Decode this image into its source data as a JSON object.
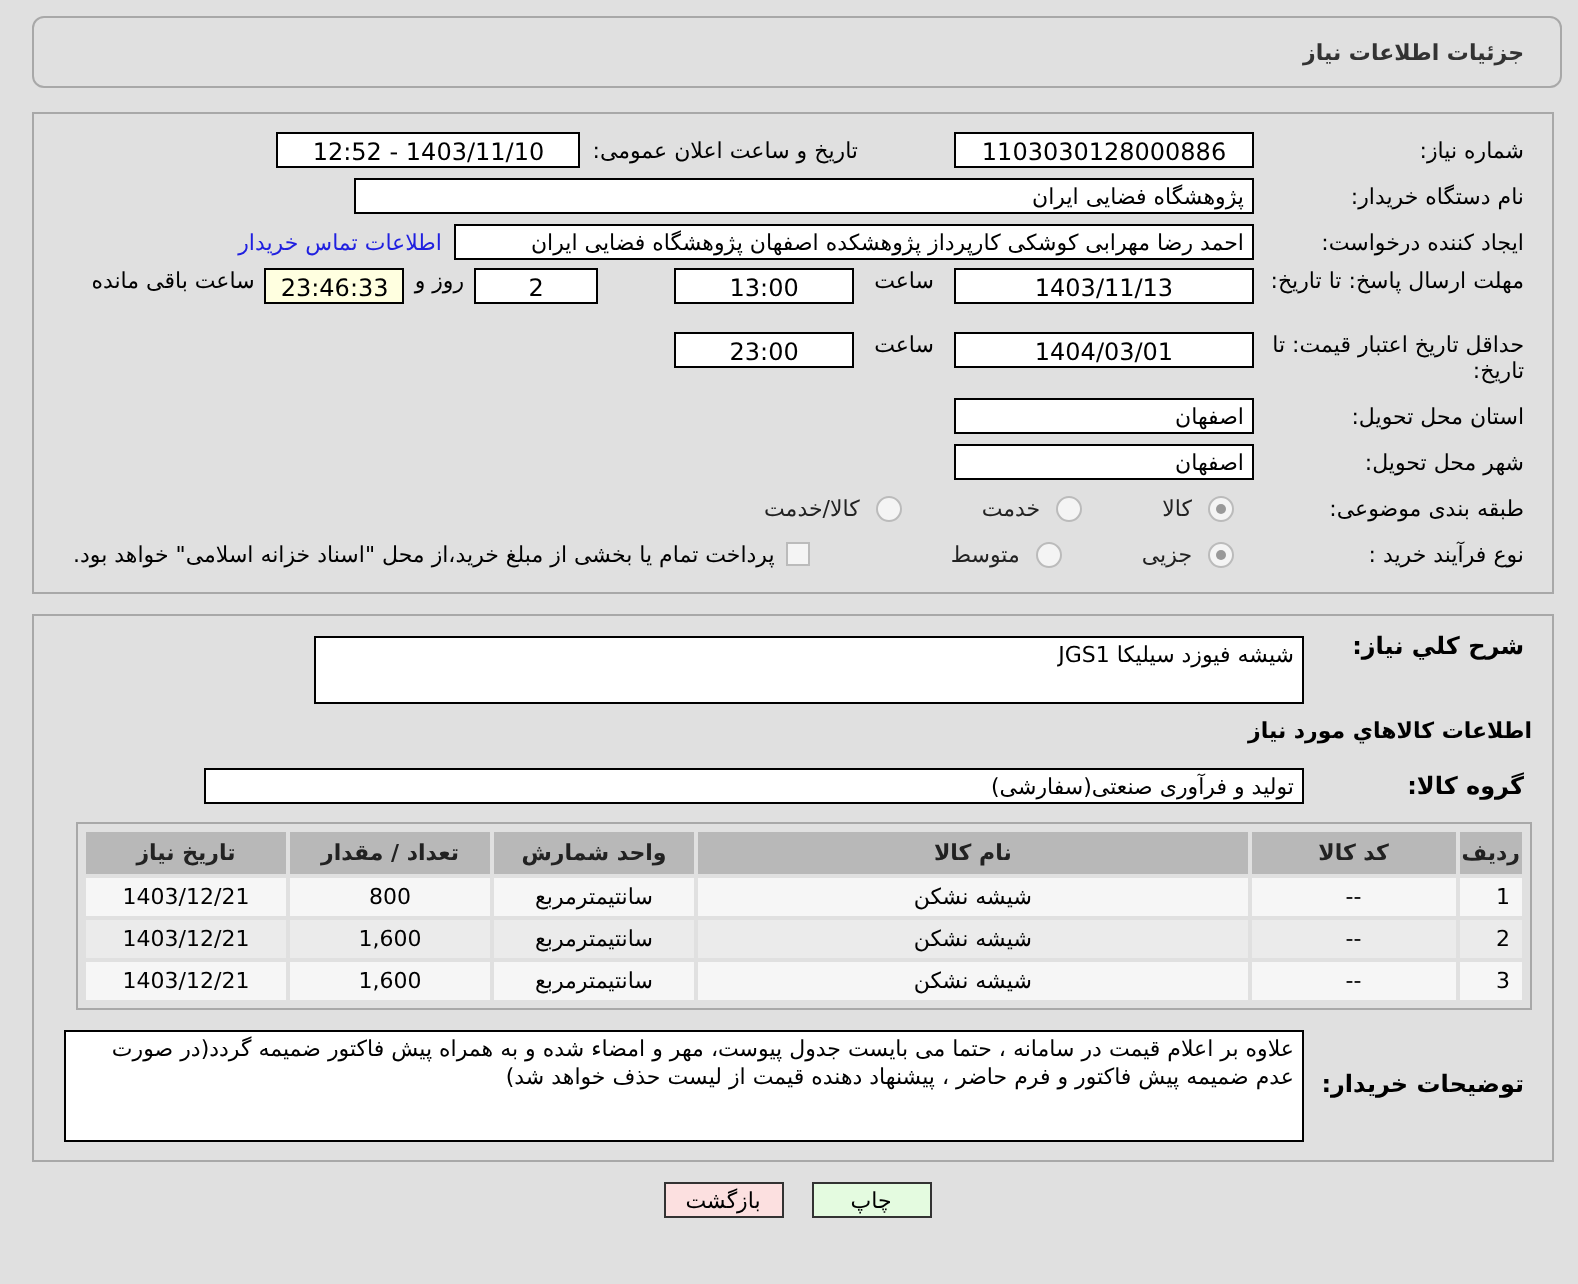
{
  "header": {
    "title": "جزئیات اطلاعات نیاز"
  },
  "need_number": {
    "label": "شماره نیاز:",
    "value": "1103030128000886"
  },
  "announce": {
    "label": "تاریخ و ساعت اعلان عمومی:",
    "value": "1403/11/10 - 12:52"
  },
  "buyer_org": {
    "label": "نام دستگاه خریدار:",
    "value": "پژوهشگاه فضایی ایران"
  },
  "requester": {
    "label": "ایجاد کننده درخواست:",
    "value": "احمد رضا مهرابی کوشکی کارپرداز پژوهشکده اصفهان پژوهشگاه فضایی ایران",
    "link": "اطلاعات تماس خریدار"
  },
  "deadline": {
    "label": "مهلت ارسال پاسخ: تا تاریخ:",
    "date": "1403/11/13",
    "time_label": "ساعت",
    "time": "13:00",
    "days": "2",
    "days_label": "روز و",
    "remaining": "23:46:33",
    "remaining_label": "ساعت باقی مانده"
  },
  "validity": {
    "label": "حداقل تاریخ اعتبار قیمت: تا تاریخ:",
    "date": "1404/03/01",
    "time_label": "ساعت",
    "time": "23:00"
  },
  "province": {
    "label": "استان محل تحویل:",
    "value": "اصفهان"
  },
  "city": {
    "label": "شهر محل تحویل:",
    "value": "اصفهان"
  },
  "category": {
    "label": "طبقه بندی موضوعی:",
    "options": [
      {
        "label": "کالا",
        "selected": true
      },
      {
        "label": "خدمت",
        "selected": false
      },
      {
        "label": "کالا/خدمت",
        "selected": false
      }
    ]
  },
  "process": {
    "label": "نوع فرآیند خرید :",
    "options": [
      {
        "label": "جزیی",
        "selected": true
      },
      {
        "label": "متوسط",
        "selected": false
      }
    ],
    "treasury": {
      "label": "پرداخت تمام یا بخشی از مبلغ خرید،از محل \"اسناد خزانه اسلامی\" خواهد بود.",
      "checked": false
    }
  },
  "summary": {
    "label": "شرح کلي نياز:",
    "value": "شیشه فیوزد سیلیکا JGS1"
  },
  "items_heading": "اطلاعات كالاهاي مورد نياز",
  "goods_group": {
    "label": "گروه کالا:",
    "value": "تولید و فرآوری صنعتی(سفارشی)"
  },
  "table": {
    "columns": [
      "ردیف",
      "کد کالا",
      "نام کالا",
      "واحد شمارش",
      "تعداد / مقدار",
      "تاریخ نیاز"
    ],
    "rows": [
      [
        "1",
        "--",
        "شیشه نشکن",
        "سانتیمترمربع",
        "800",
        "1403/12/21"
      ],
      [
        "2",
        "--",
        "شیشه نشکن",
        "سانتیمترمربع",
        "1,600",
        "1403/12/21"
      ],
      [
        "3",
        "--",
        "شیشه نشکن",
        "سانتیمترمربع",
        "1,600",
        "1403/12/21"
      ]
    ]
  },
  "notes": {
    "label": "توضیحات خریدار:",
    "value": "علاوه بر اعلام قیمت در سامانه ، حتما می بایست جدول پیوست، مهر و امضاء شده و به همراه پیش فاکتور ضمیمه گردد(در صورت عدم ضمیمه پیش فاکتور و فرم حاضر ، پیشنهاد دهنده قیمت از لیست حذف خواهد شد)"
  },
  "buttons": [
    {
      "label": "چاپ",
      "kind": "print"
    },
    {
      "label": "بازگشت",
      "kind": "back"
    }
  ]
}
